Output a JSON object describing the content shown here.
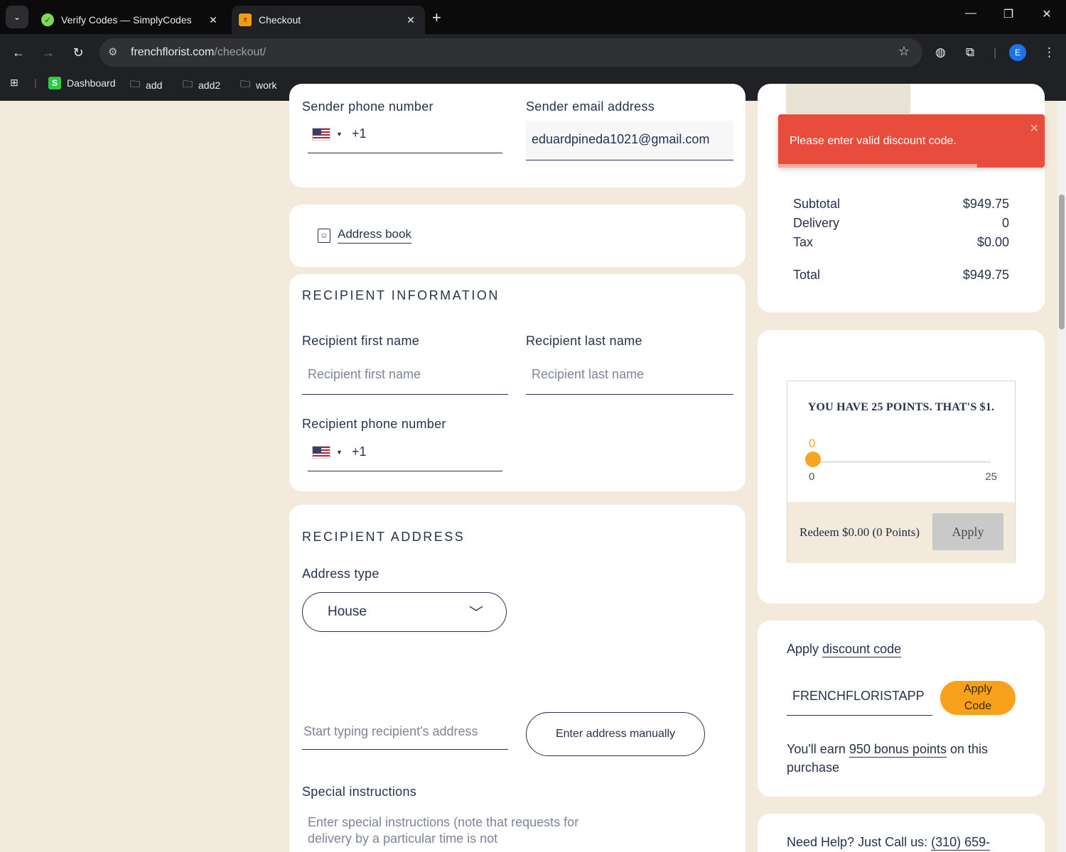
{
  "browser": {
    "tabs": [
      {
        "title": "Verify Codes — SimplyCodes",
        "active": false
      },
      {
        "title": "Checkout",
        "active": true
      }
    ],
    "url_domain": "frenchflorist.com",
    "url_path": "/checkout/",
    "profile_initial": "E",
    "bookmarks": [
      "Dashboard",
      "add",
      "add2",
      "work"
    ]
  },
  "sender": {
    "phone_label": "Sender phone number",
    "phone_country_code": "+1",
    "email_label": "Sender email address",
    "email_value": "eduardpineda1021@gmail.com"
  },
  "address_book": {
    "label": "Address book"
  },
  "recipient_info": {
    "title": "RECIPIENT INFORMATION",
    "first_name_label": "Recipient first name",
    "first_name_placeholder": "Recipient first name",
    "last_name_label": "Recipient last name",
    "last_name_placeholder": "Recipient last name",
    "phone_label": "Recipient phone number",
    "phone_country_code": "+1"
  },
  "recipient_address": {
    "title": "RECIPIENT ADDRESS",
    "address_type_label": "Address type",
    "address_type_value": "House",
    "address_placeholder": "Start typing recipient's address",
    "manual_button": "Enter address manually",
    "special_label": "Special instructions",
    "special_placeholder": "Enter special instructions (note that requests for delivery by a particular time is not"
  },
  "toast": {
    "message": "Please enter valid discount code."
  },
  "summary": {
    "rows": [
      {
        "label": "Subtotal",
        "value": "$949.75"
      },
      {
        "label": "Delivery",
        "value": "0"
      },
      {
        "label": "Tax",
        "value": "$0.00"
      }
    ],
    "total_label": "Total",
    "total_value": "$949.75"
  },
  "loyalty": {
    "headline": "YOU HAVE 25 POINTS. THAT'S $1.",
    "slider_value": "0",
    "slider_min": "0",
    "slider_max": "25",
    "slider_fraction": 0,
    "redeem_text": "Redeem $0.00 (0 Points)",
    "apply_label": "Apply"
  },
  "discount": {
    "label_prefix": "Apply",
    "label_link": "discount code",
    "code_value": "FRENCHFLORISTAPP",
    "apply_label_1": "Apply",
    "apply_label_2": "Code",
    "earn_prefix": "You'll earn",
    "earn_link": "950 bonus points",
    "earn_suffix": "on this",
    "earn_line2": "purchase"
  },
  "help": {
    "prefix": "Need Help? Just Call us:",
    "phone": "(310) 659-"
  },
  "colors": {
    "accent": "#f9a11b",
    "toast": "#e74c3c",
    "page_bg": "#f4eadb",
    "text": "#27324f"
  }
}
